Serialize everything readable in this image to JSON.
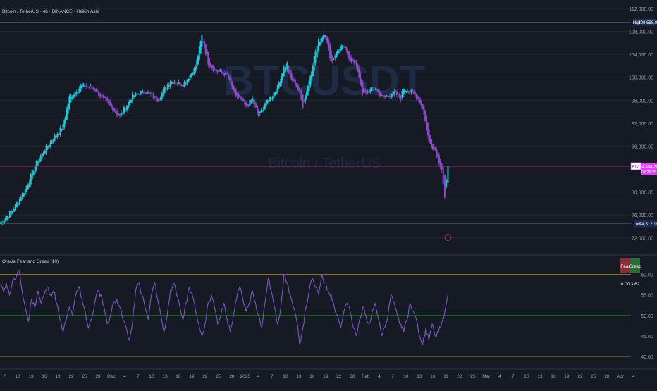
{
  "header": {
    "symbol_title": "Bitcoin / TetherUS · 4h · BINANCE · Heikin Ashi",
    "indicator_title": "Oracle Fear and Greed (10)"
  },
  "colors": {
    "background": "#161a25",
    "grid": "#232733",
    "candle_up": "#22c7d6",
    "candle_down": "#8a4bc7",
    "current_price_line": "#c2185b",
    "oscillator_line": "#7e57c2",
    "level_mid": "#2e7d32",
    "level_bounds": "#827717",
    "fear": "#8b2e3c",
    "greed": "#2e6b3a",
    "high_low_tag": "#1e2d55",
    "price_tag": "#e040fb",
    "watermark": "#1f2a44"
  },
  "price_pane": {
    "axis_labels": [
      "112,000.00",
      "108,000.00",
      "104,000.00",
      "100,000.00",
      "96,000.00",
      "92,000.00",
      "88,000.00",
      "80,000.00",
      "76,000.00",
      "72,000.00"
    ],
    "high_label": "High",
    "high_value": "109,588.00",
    "low_label": "Low",
    "low_value": "74,512.19",
    "symbol_tag": "BTCUSDT",
    "last_price": "84,498.28",
    "countdown": "02:26:25",
    "watermark_symbol": "BTCUSDT",
    "watermark_sub": "Bitcoin / TetherUS"
  },
  "oscillator_pane": {
    "axis_labels": [
      "60.00",
      "55.00",
      "50.00",
      "45.00",
      "40.00"
    ],
    "fear_label": "Fear",
    "greed_label": "Greed",
    "fear_value": "0.00",
    "greed_value": "3.62"
  },
  "time_axis": {
    "labels": [
      "7",
      "10",
      "13",
      "16",
      "19",
      "22",
      "25",
      "28",
      "Dec",
      "4",
      "7",
      "10",
      "13",
      "16",
      "19",
      "22",
      "25",
      "28",
      "2025",
      "4",
      "7",
      "10",
      "13",
      "16",
      "19",
      "22",
      "28",
      "Feb",
      "4",
      "7",
      "10",
      "13",
      "16",
      "19",
      "22",
      "25",
      "Mar",
      "4",
      "7",
      "10",
      "13",
      "16",
      "19",
      "22",
      "25",
      "28",
      "Apr",
      "4",
      "7",
      "10"
    ]
  },
  "chart_data": [
    {
      "type": "candlestick",
      "series": [
        {
          "name": "BTCUSDT",
          "values": [
            [
              0,
              74512
            ],
            [
              4,
              76800
            ],
            [
              8,
              80500
            ],
            [
              12,
              85600
            ],
            [
              16,
              88800
            ],
            [
              20,
              91500
            ],
            [
              22,
              96500
            ],
            [
              26,
              98600
            ],
            [
              30,
              97900
            ],
            [
              34,
              95500
            ],
            [
              38,
              93200
            ],
            [
              42,
              96800
            ],
            [
              46,
              97600
            ],
            [
              50,
              96100
            ],
            [
              54,
              99400
            ],
            [
              58,
              98700
            ],
            [
              62,
              101800
            ],
            [
              64,
              107200
            ],
            [
              66,
              102600
            ],
            [
              68,
              101200
            ],
            [
              72,
              100400
            ],
            [
              74,
              97300
            ],
            [
              76,
              96300
            ],
            [
              78,
              94800
            ],
            [
              80,
              96200
            ],
            [
              82,
              93200
            ],
            [
              84,
              95400
            ],
            [
              86,
              96600
            ],
            [
              88,
              98300
            ],
            [
              90,
              101700
            ],
            [
              91,
              102300
            ],
            [
              92,
              99700
            ],
            [
              94,
              98600
            ],
            [
              95,
              97000
            ],
            [
              96,
              95100
            ],
            [
              98,
              99400
            ],
            [
              100,
              104500
            ],
            [
              101,
              106200
            ],
            [
              103,
              107800
            ],
            [
              105,
              102700
            ],
            [
              107,
              104600
            ],
            [
              109,
              105300
            ],
            [
              111,
              103200
            ],
            [
              113,
              102100
            ],
            [
              115,
              97000
            ],
            [
              117,
              97600
            ],
            [
              119,
              98100
            ],
            [
              121,
              96500
            ],
            [
              123,
              96800
            ],
            [
              125,
              97300
            ],
            [
              127,
              96400
            ],
            [
              128,
              98100
            ],
            [
              130,
              97500
            ],
            [
              132,
              96800
            ],
            [
              134,
              94700
            ],
            [
              136,
              88600
            ],
            [
              138,
              87300
            ],
            [
              140,
              84000
            ],
            [
              141,
              78900
            ],
            [
              142,
              84500
            ]
          ]
        }
      ],
      "ylim": [
        70000,
        112000
      ]
    },
    {
      "type": "line",
      "title": "Oracle Fear and Greed (10)",
      "series": [
        {
          "name": "Oracle Fear and Greed (10)",
          "values": [
            [
              0,
              57.5
            ],
            [
              1,
              56
            ],
            [
              2,
              58
            ],
            [
              3,
              55
            ],
            [
              4,
              58.5
            ],
            [
              5,
              59
            ],
            [
              6,
              61
            ],
            [
              7,
              56
            ],
            [
              8,
              52
            ],
            [
              9,
              48.5
            ],
            [
              10,
              54
            ],
            [
              11,
              52
            ],
            [
              12,
              56
            ],
            [
              13,
              53
            ],
            [
              14,
              55
            ],
            [
              15,
              57
            ],
            [
              16,
              55
            ],
            [
              17,
              56
            ],
            [
              18,
              53
            ],
            [
              19,
              49
            ],
            [
              20,
              46
            ],
            [
              21,
              49
            ],
            [
              22,
              52
            ],
            [
              23,
              50
            ],
            [
              24,
              55
            ],
            [
              25,
              57
            ],
            [
              26,
              54
            ],
            [
              27,
              51
            ],
            [
              28,
              47
            ],
            [
              29,
              49
            ],
            [
              30,
              53
            ],
            [
              31,
              56
            ],
            [
              32,
              55
            ],
            [
              33,
              52
            ],
            [
              34,
              48
            ],
            [
              35,
              50
            ],
            [
              36,
              53
            ],
            [
              37,
              54
            ],
            [
              38,
              52
            ],
            [
              39,
              49
            ],
            [
              40,
              47
            ],
            [
              41,
              44
            ],
            [
              42,
              48
            ],
            [
              43,
              56
            ],
            [
              44,
              58
            ],
            [
              45,
              55
            ],
            [
              46,
              52
            ],
            [
              47,
              49
            ],
            [
              48,
              55
            ],
            [
              49,
              58
            ],
            [
              50,
              54
            ],
            [
              51,
              50
            ],
            [
              52,
              46
            ],
            [
              53,
              50
            ],
            [
              54,
              56
            ],
            [
              55,
              58
            ],
            [
              56,
              55
            ],
            [
              57,
              52
            ],
            [
              58,
              49
            ],
            [
              59,
              53
            ],
            [
              60,
              57
            ],
            [
              61,
              55
            ],
            [
              62,
              51
            ],
            [
              63,
              48
            ],
            [
              64,
              45
            ],
            [
              65,
              48
            ],
            [
              66,
              53
            ],
            [
              67,
              55
            ],
            [
              68,
              52
            ],
            [
              69,
              48
            ],
            [
              70,
              50
            ],
            [
              71,
              53
            ],
            [
              72,
              49
            ],
            [
              73,
              46
            ],
            [
              74,
              50
            ],
            [
              75,
              54
            ],
            [
              76,
              57
            ],
            [
              77,
              54
            ],
            [
              78,
              51
            ],
            [
              79,
              53
            ],
            [
              80,
              56
            ],
            [
              81,
              53
            ],
            [
              82,
              50
            ],
            [
              83,
              47
            ],
            [
              84,
              53
            ],
            [
              85,
              59
            ],
            [
              86,
              56
            ],
            [
              87,
              52
            ],
            [
              88,
              48
            ],
            [
              89,
              52
            ],
            [
              90,
              60
            ],
            [
              91,
              58
            ],
            [
              92,
              55
            ],
            [
              93,
              52
            ],
            [
              94,
              49
            ],
            [
              95,
              43
            ],
            [
              96,
              47
            ],
            [
              97,
              52
            ],
            [
              98,
              56
            ],
            [
              99,
              59
            ],
            [
              100,
              57
            ],
            [
              101,
              55
            ],
            [
              102,
              60
            ],
            [
              103,
              58
            ],
            [
              104,
              56
            ],
            [
              105,
              55
            ],
            [
              106,
              52
            ],
            [
              107,
              50
            ],
            [
              108,
              47
            ],
            [
              109,
              51
            ],
            [
              110,
              53
            ],
            [
              111,
              51
            ],
            [
              112,
              47
            ],
            [
              113,
              45
            ],
            [
              114,
              49
            ],
            [
              115,
              52
            ],
            [
              116,
              50
            ],
            [
              117,
              48
            ],
            [
              118,
              51
            ],
            [
              119,
              53
            ],
            [
              120,
              49
            ],
            [
              121,
              45
            ],
            [
              122,
              47
            ],
            [
              123,
              50
            ],
            [
              124,
              55
            ],
            [
              125,
              53
            ],
            [
              126,
              50
            ],
            [
              127,
              48
            ],
            [
              128,
              46
            ],
            [
              129,
              49
            ],
            [
              130,
              53
            ],
            [
              131,
              51
            ],
            [
              132,
              49
            ],
            [
              133,
              45
            ],
            [
              134,
              43
            ],
            [
              135,
              47
            ],
            [
              136,
              44
            ],
            [
              137,
              48
            ],
            [
              138,
              45
            ],
            [
              139,
              46
            ],
            [
              140,
              48
            ],
            [
              141,
              51
            ],
            [
              142,
              55
            ]
          ]
        }
      ],
      "ylim": [
        39,
        63
      ],
      "levels": [
        40,
        50,
        60
      ]
    }
  ]
}
